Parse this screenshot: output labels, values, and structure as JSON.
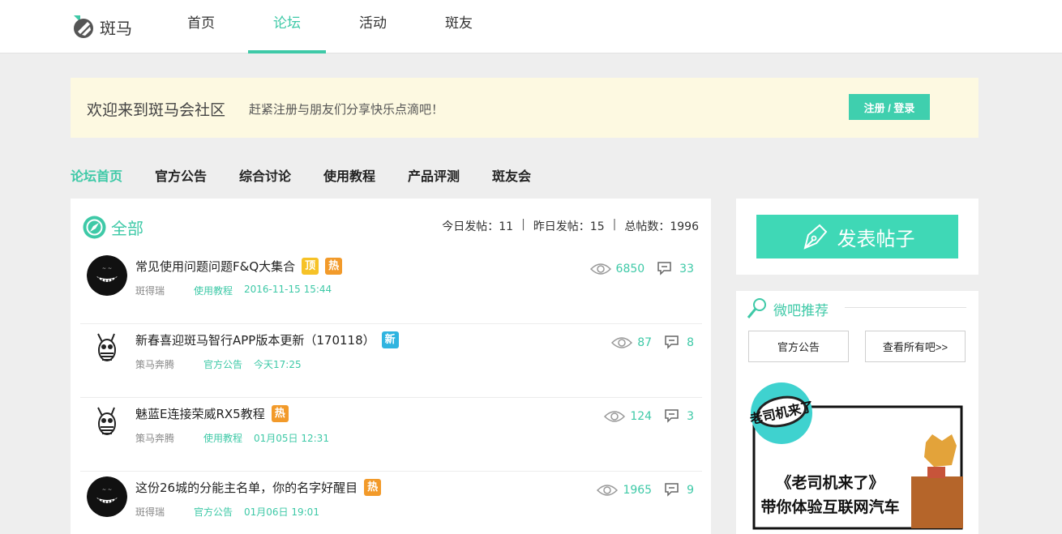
{
  "header": {
    "logo_text": "斑马",
    "nav": [
      {
        "label": "首页",
        "active": false
      },
      {
        "label": "论坛",
        "active": true
      },
      {
        "label": "活动",
        "active": false
      },
      {
        "label": "斑友",
        "active": false
      }
    ]
  },
  "banner": {
    "title": "欢迎来到斑马会社区",
    "subtitle": "赶紧注册与朋友们分享快乐点滴吧！",
    "button": "注册 / 登录"
  },
  "subnav": [
    {
      "label": "论坛首页",
      "active": true
    },
    {
      "label": "官方公告",
      "active": false
    },
    {
      "label": "综合讨论",
      "active": false
    },
    {
      "label": "使用教程",
      "active": false
    },
    {
      "label": "产品评测",
      "active": false
    },
    {
      "label": "斑友会",
      "active": false
    }
  ],
  "feed": {
    "title": "全部",
    "stats": {
      "today": "今日发帖：11",
      "yesterday": "昨日发帖：15",
      "total": "总帖数：1996",
      "separator": "|"
    },
    "posts": [
      {
        "title": "常见使用问题问题F&Q大集合",
        "tags": [
          {
            "text": "顶",
            "kind": "top"
          },
          {
            "text": "热",
            "kind": "hot"
          }
        ],
        "author": "斑得瑞",
        "category": "使用教程",
        "date": "2016-11-15 15:44",
        "views": "6850",
        "replies": "33",
        "avatar": "grin-avatar"
      },
      {
        "title": "新春喜迎斑马智行APP版本更新（170118）",
        "tags": [
          {
            "text": "新",
            "kind": "new"
          }
        ],
        "author": "策马奔腾",
        "category": "官方公告",
        "date": "今天17:25",
        "views": "87",
        "replies": "8",
        "avatar": "zebra-avatar"
      },
      {
        "title": "魅蓝E连接荣威RX5教程",
        "tags": [
          {
            "text": "热",
            "kind": "hot"
          }
        ],
        "author": "策马奔腾",
        "category": "使用教程",
        "date": "01月05日 12:31",
        "views": "124",
        "replies": "3",
        "avatar": "zebra-avatar"
      },
      {
        "title": "这份26城的分能主名单，你的名字好醒目",
        "tags": [
          {
            "text": "热",
            "kind": "hot"
          }
        ],
        "author": "斑得瑞",
        "category": "官方公告",
        "date": "01月06日 19:01",
        "views": "1965",
        "replies": "9",
        "avatar": "grin-avatar"
      }
    ]
  },
  "sidebar": {
    "publish_label": "发表帖子",
    "weiba": {
      "title": "微吧推荐",
      "buttons": [
        "官方公告",
        "查看所有吧>>"
      ]
    },
    "promo": {
      "badge": "老司机来了",
      "line1": "《老司机来了》",
      "line2": "带你体验互联网汽车"
    }
  },
  "colors": {
    "accent": "#3ec9a7",
    "banner_bg": "#fdf9e1",
    "tag_top": "#f6c227",
    "tag_hot": "#f29a2a",
    "tag_new": "#2fb4e0"
  }
}
